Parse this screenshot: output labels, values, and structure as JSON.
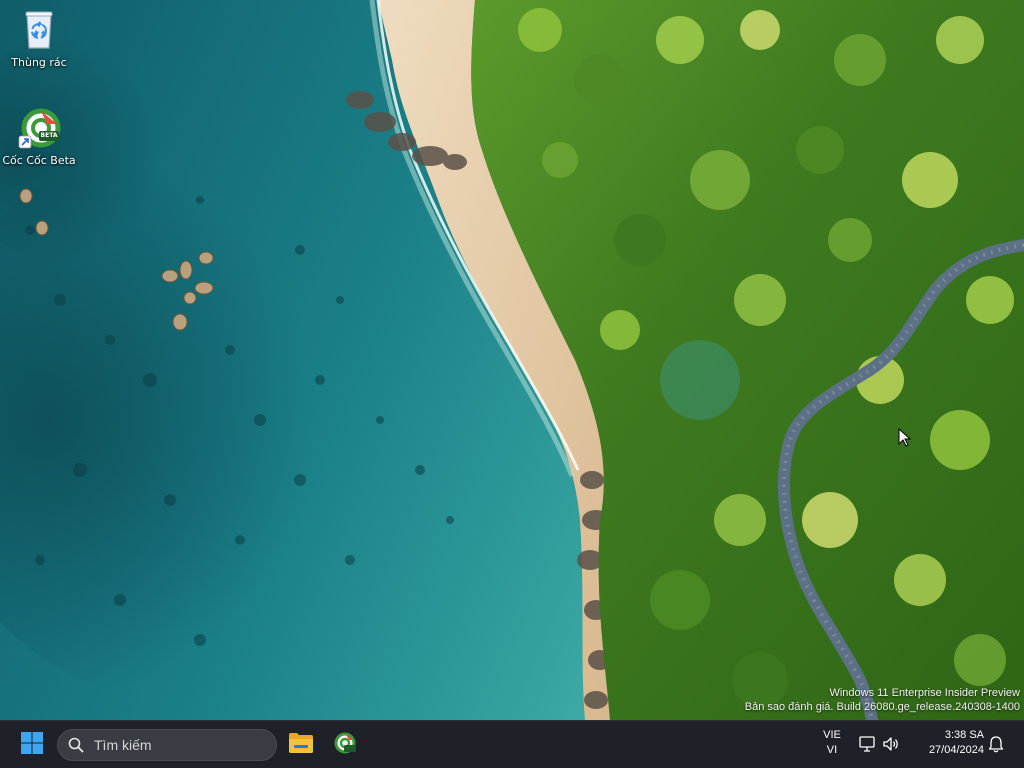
{
  "desktop": {
    "icons": [
      {
        "label": "Thùng rác",
        "icon": "recycle-bin-icon"
      },
      {
        "label": "Cốc Cốc Beta",
        "icon": "coccoc-beta-icon",
        "badge": "BETA"
      }
    ]
  },
  "watermark": {
    "line1": "Windows 11 Enterprise Insider Preview",
    "line2": "Bản sao đánh giá. Build 26080.ge_release.240308-1400"
  },
  "taskbar": {
    "start_icon": "windows-start-icon",
    "search": {
      "placeholder": "Tìm kiếm",
      "icon": "search-icon"
    },
    "pinned": [
      {
        "name": "File Explorer",
        "icon": "folder-icon"
      },
      {
        "name": "Cốc Cốc Beta",
        "icon": "coccoc-icon"
      }
    ],
    "language": {
      "line1": "VIE",
      "line2": "VI"
    },
    "tray": [
      "network-icon",
      "volume-icon"
    ],
    "clock": {
      "time": "3:38 SA",
      "date": "27/04/2024"
    },
    "notifications_icon": "bell-icon"
  },
  "colors": {
    "taskbar_bg": "#1f2128",
    "start_blue": "#3ea6f0",
    "coccoc_green": "#3b9a3a",
    "folder_yellow": "#f3c23b"
  }
}
